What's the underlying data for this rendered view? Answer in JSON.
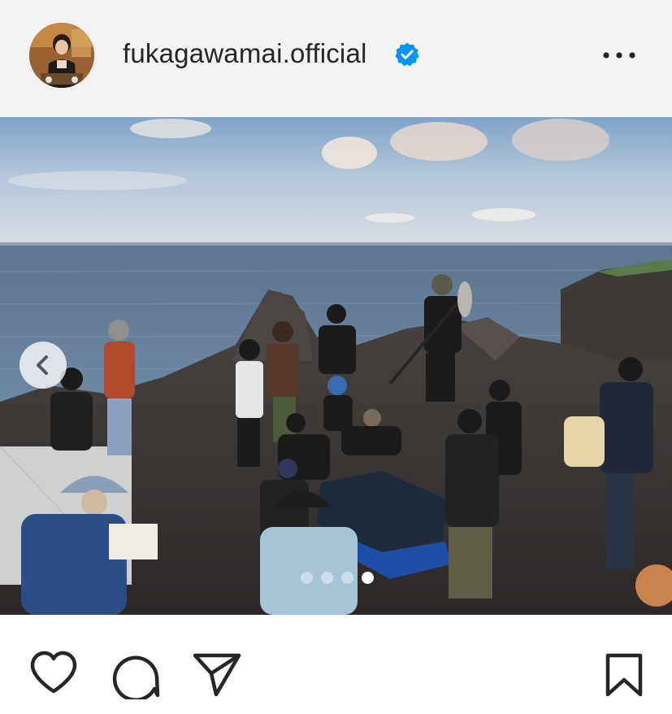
{
  "post": {
    "username": "fukagawamai.official",
    "verified": true,
    "carousel": {
      "total": 4,
      "active_index": 3
    }
  },
  "icons": {
    "avatar": "avatar-image",
    "verified": "verified-badge-icon",
    "more": "more-options-icon",
    "prev": "chevron-left-icon",
    "like": "heart-icon",
    "comment": "comment-icon",
    "share": "send-icon",
    "save": "bookmark-icon"
  },
  "colors": {
    "header_bg": "#f3f3f3",
    "verified_blue": "#0095f6",
    "icon": "#262626"
  }
}
